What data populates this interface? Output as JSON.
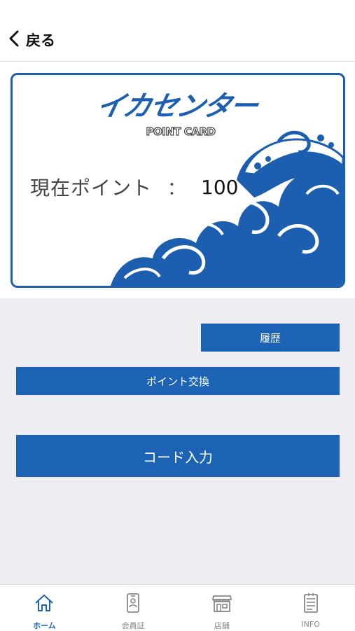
{
  "header": {
    "back_label": "戻る",
    "back_icon": "chevron-left-icon"
  },
  "card": {
    "logo_text": "イカセンター",
    "subtitle": "POINT CARD",
    "points_label": "現在ポイント",
    "points_separator": "：",
    "points_value": "100",
    "accent_color": "#1c5fb0"
  },
  "actions": {
    "history_label": "履歴",
    "exchange_label": "ポイント交換",
    "code_input_label": "コード入力",
    "button_color": "#1c63b5"
  },
  "tabbar": {
    "items": [
      {
        "label": "ホーム",
        "icon": "home-icon",
        "active": true
      },
      {
        "label": "会員証",
        "icon": "member-card-icon",
        "active": false
      },
      {
        "label": "店舗",
        "icon": "store-icon",
        "active": false
      },
      {
        "label": "INFO",
        "icon": "info-document-icon",
        "active": false
      }
    ]
  }
}
